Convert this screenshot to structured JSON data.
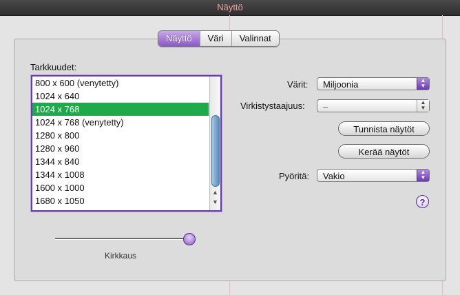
{
  "window": {
    "title": "Näyttö"
  },
  "tabs": [
    {
      "label": "Näyttö",
      "active": true
    },
    {
      "label": "Väri",
      "active": false
    },
    {
      "label": "Valinnat",
      "active": false
    }
  ],
  "resolutions": {
    "label": "Tarkkuudet:",
    "items": [
      "800 x 600 (venytetty)",
      "1024 x 640",
      "1024 x 768",
      "1024 x 768 (venytetty)",
      "1280 x 800",
      "1280 x 960",
      "1344 x 840",
      "1344 x 1008",
      "1600 x 1000",
      "1680 x 1050"
    ],
    "selected_index": 2
  },
  "brightness": {
    "label": "Kirkkaus"
  },
  "colors": {
    "label": "Värit:",
    "value": "Miljoonia"
  },
  "refresh": {
    "label": "Virkistystaajuus:",
    "value": "–"
  },
  "buttons": {
    "detect": "Tunnista näytöt",
    "gather": "Kerää näytöt"
  },
  "rotate": {
    "label": "Pyöritä:",
    "value": "Vakio"
  },
  "help": {
    "symbol": "?"
  },
  "accent_colors": {
    "selection": "#1faa4a",
    "aqua": "#6a3ab0"
  }
}
